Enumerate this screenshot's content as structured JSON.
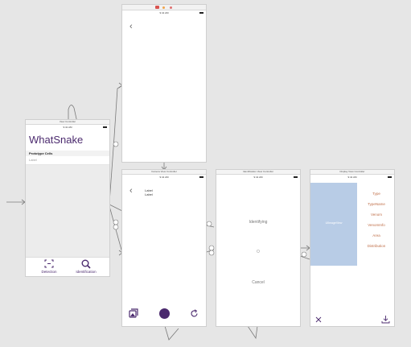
{
  "colors": {
    "accent": "#4b2a6e",
    "selection": "#b8cce6",
    "canvas": "#e6e6e6",
    "label": "#c0704a"
  },
  "status_time": "9:41 AM",
  "root": {
    "scene_title": "View Controller",
    "app_title": "WhatSnake",
    "section_header": "Prototype Cells",
    "cell_label": "Label",
    "tabs": [
      {
        "label": "Detection",
        "icon": "scan-frame-icon"
      },
      {
        "label": "Identification",
        "icon": "magnifier-icon"
      }
    ]
  },
  "camera": {
    "scene_title": "Camera View Controller",
    "labels": [
      "Label",
      "Label"
    ]
  },
  "identification": {
    "scene_title": "Identification View Controller",
    "label_top": "Identifying",
    "label_mid": "O",
    "label_bottom": "Cancel"
  },
  "display": {
    "scene_title": "Display View Controller",
    "image_label": "UIImageView",
    "items": [
      "Type",
      "TypeName",
      "Venom",
      "VenomInfo",
      "Area",
      "Distribution"
    ]
  }
}
